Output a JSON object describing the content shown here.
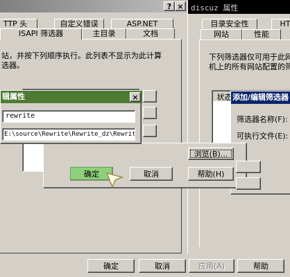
{
  "left_window": {
    "title_help_glyph": "?",
    "title_close_glyph": "×",
    "tabs_row1": [
      "TTP 头",
      "自定义错误",
      "ASP.NET"
    ],
    "tabs_row2": [
      "ISAPI 筛选器",
      "主目录",
      "文档"
    ],
    "description_line1": "站，并按下列顺序执行。此列表不显示为此计算",
    "description_line2": "选器。"
  },
  "right_window": {
    "title": "discuz 属性",
    "tabs_row1": [
      "目录安全性",
      "HT"
    ],
    "tabs_row2": [
      "网站",
      "性能"
    ],
    "description_line1": "下列筛选器仅可用于此网",
    "description_line2": "机上的所有网站配置的筛",
    "list_header_status": "状态"
  },
  "small_dialog": {
    "title": "辑属性",
    "close_glyph": "×",
    "filter_name_value": "rewrite",
    "executable_value": "E:\\source\\Rewrite\\Rewrite_dz\\Rewrit"
  },
  "main_dialog": {
    "browse_label": "浏览(B)...",
    "ok_label": "确定",
    "cancel_label": "取消",
    "help_label": "帮助(H)"
  },
  "right_dialog": {
    "title": "添加/编辑筛选器",
    "filter_name_label": "筛选器名称(F):",
    "executable_label": "可执行文件(E):"
  },
  "bottom_bar": {
    "ok_label": "确定",
    "cancel_label": "取消",
    "apply_label": "应用(A)",
    "help_label": "帮助"
  },
  "colors": {
    "dialog_bg": "#D4D0C8",
    "active_title": "#0A246A",
    "green_title": "#4E7A34",
    "green_button": "#8FD07A"
  }
}
